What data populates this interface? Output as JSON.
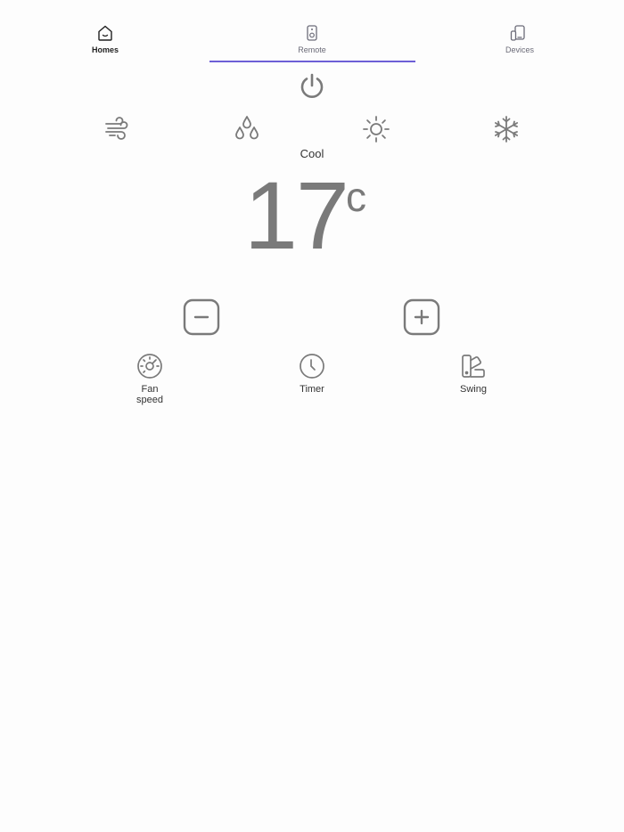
{
  "tabs": [
    {
      "label": "Homes",
      "icon": "home-icon",
      "active": false
    },
    {
      "label": "Remote",
      "icon": "remote-icon",
      "active": true
    },
    {
      "label": "Devices",
      "icon": "devices-icon",
      "active": false
    }
  ],
  "colors": {
    "accent": "#6d5fd6",
    "icon": "#7a7a7a",
    "background": "#fdfdfd"
  },
  "controls": {
    "power_icon": "power-icon",
    "modes": [
      {
        "name": "fan",
        "icon": "wind-icon"
      },
      {
        "name": "dry",
        "icon": "droplets-icon"
      },
      {
        "name": "heat",
        "icon": "sun-icon"
      },
      {
        "name": "cool",
        "icon": "snowflake-icon"
      }
    ],
    "current_mode": "Cool",
    "temperature": "17",
    "unit": "c",
    "decrease_icon": "minus-square-icon",
    "increase_icon": "plus-square-icon"
  },
  "functions": [
    {
      "label": "Fan\nspeed",
      "icon": "gauge-icon"
    },
    {
      "label": "Timer",
      "icon": "clock-icon"
    },
    {
      "label": "Swing",
      "icon": "swatch-icon"
    }
  ]
}
